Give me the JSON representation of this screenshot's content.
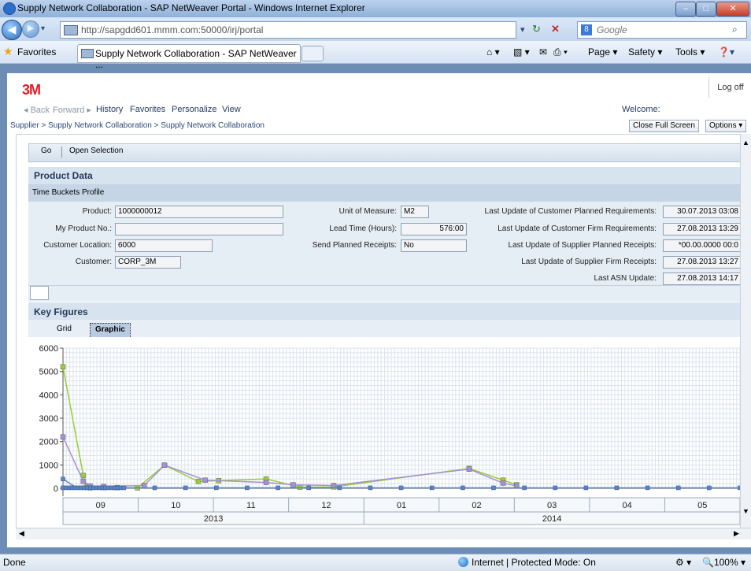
{
  "window": {
    "title": "Supply Network Collaboration - SAP NetWeaver Portal - Windows Internet Explorer",
    "url": "http://sapgdd601.mmm.com:50000/irj/portal",
    "search_placeholder": "Google",
    "favorites_label": "Favorites",
    "tab_label": "Supply Network Collaboration - SAP NetWeaver ...",
    "commands": [
      "Page ▾",
      "Safety ▾",
      "Tools ▾"
    ]
  },
  "portal": {
    "logo": "3M",
    "logoff": "Log off",
    "nav": {
      "back": "◂ Back",
      "forward": "Forward ▸",
      "history": "History",
      "favorites": "Favorites",
      "personalize": "Personalize",
      "view": "View",
      "welcome": "Welcome:"
    },
    "breadcrumb": "Supplier  >  Supply Network Collaboration  >  Supply Network Collaboration",
    "close_full_screen": "Close Full Screen",
    "options": "Options ▾"
  },
  "toolbar": {
    "go": "Go",
    "open_selection": "Open Selection"
  },
  "product_data": {
    "title": "Product Data",
    "subtitle": "Time Buckets Profile",
    "fields": {
      "product_label": "Product:",
      "product": "1000000012",
      "my_product_label": "My Product No.:",
      "my_product": "",
      "customer_location_label": "Customer Location:",
      "customer_location": "6000",
      "customer_label": "Customer:",
      "customer": "CORP_3M",
      "uom_label": "Unit of Measure:",
      "uom": "M2",
      "lead_time_label": "Lead Time (Hours):",
      "lead_time": "576:00",
      "send_planned_label": "Send Planned Receipts:",
      "send_planned": "No",
      "lu_cust_planned_label": "Last Update of Customer Planned Requirements:",
      "lu_cust_planned": "30.07.2013 03:08",
      "lu_cust_firm_label": "Last Update of Customer Firm Requirements:",
      "lu_cust_firm": "27.08.2013 13:29",
      "lu_supp_planned_label": "Last Update of Supplier Planned Receipts:",
      "lu_supp_planned": "*00.00.0000 00:0",
      "lu_supp_firm_label": "Last Update of Supplier Firm Receipts:",
      "lu_supp_firm": "27.08.2013 13:27",
      "lu_asn_label": "Last ASN Update:",
      "lu_asn": "27.08.2013 14:17"
    }
  },
  "key_figures": {
    "title": "Key Figures",
    "tab_grid": "Grid",
    "tab_graphic": "Graphic"
  },
  "colors": {
    "green": "#9acd32",
    "purple": "#a58fd9",
    "blue": "#5b84c4"
  },
  "chart_data": {
    "type": "line",
    "ylim": [
      0,
      6000
    ],
    "yticks": [
      0,
      1000,
      2000,
      3000,
      4000,
      5000,
      6000
    ],
    "month_labels": [
      "09",
      "10",
      "11",
      "12",
      "01",
      "02",
      "03",
      "04",
      "05"
    ],
    "year_labels": [
      "2013",
      "2014"
    ],
    "x_index_max": 100,
    "series": [
      {
        "color": "#9acd32",
        "points": [
          [
            0,
            5200
          ],
          [
            3,
            550
          ],
          [
            3.5,
            50
          ],
          [
            4,
            20
          ],
          [
            6,
            30
          ],
          [
            8,
            30
          ],
          [
            11,
            20
          ],
          [
            15,
            990
          ],
          [
            20,
            290
          ],
          [
            23,
            330
          ],
          [
            30,
            400
          ],
          [
            35,
            50
          ],
          [
            40,
            60
          ],
          [
            60,
            850
          ],
          [
            65,
            350
          ],
          [
            67,
            150
          ]
        ]
      },
      {
        "color": "#a58fd9",
        "points": [
          [
            0,
            2200
          ],
          [
            3,
            300
          ],
          [
            4,
            100
          ],
          [
            6,
            80
          ],
          [
            12,
            120
          ],
          [
            15,
            990
          ],
          [
            21,
            350
          ],
          [
            30,
            250
          ],
          [
            34,
            150
          ],
          [
            40,
            120
          ],
          [
            60,
            820
          ],
          [
            65,
            220
          ],
          [
            67,
            100
          ]
        ]
      },
      {
        "color": "#5b84c4",
        "points": [
          [
            0,
            400
          ],
          [
            2,
            20
          ],
          [
            100,
            20
          ]
        ]
      }
    ]
  },
  "status": {
    "left": "Done",
    "zone": "Internet | Protected Mode: On",
    "zoom": "100%"
  }
}
